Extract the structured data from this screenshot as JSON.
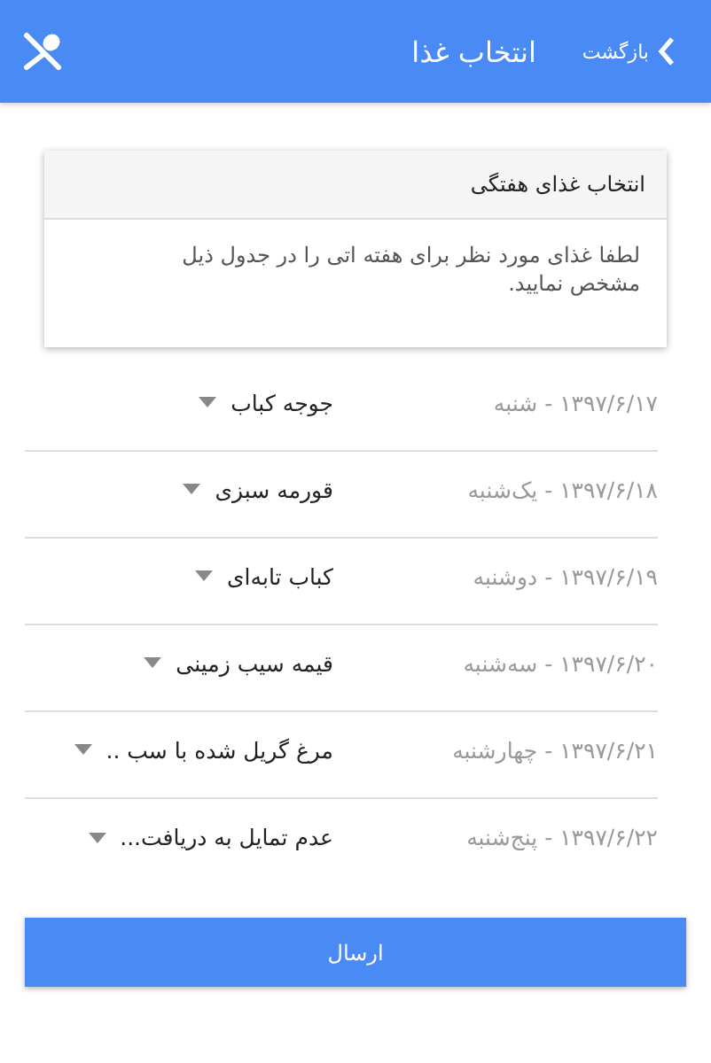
{
  "app_bar": {
    "back": "بازگشت",
    "title": "انتخاب غذا"
  },
  "card": {
    "title": "انتخاب غذای هفتگی",
    "text": "لطفا غذای مورد نظر برای هفته اتی را در جدول ذیل مشخص نمایید."
  },
  "rows": [
    {
      "date": "۱۳۹۷/۶/۱۷ - شنبه",
      "food": "جوجه کباب"
    },
    {
      "date": "۱۳۹۷/۶/۱۸ - یک‌شنبه",
      "food": "قورمه سبزی"
    },
    {
      "date": "۱۳۹۷/۶/۱۹ - دوشنبه",
      "food": "کباب تابه‌ای"
    },
    {
      "date": "۱۳۹۷/۶/۲۰ - سه‌شنبه",
      "food": "قیمه سیب زمینی"
    },
    {
      "date": "۱۳۹۷/۶/۲۱ - چهارشنبه",
      "food": "مرغ گریل شده با سب .."
    },
    {
      "date": "۱۳۹۷/۶/۲۲ - پنج‌شنبه",
      "food": "عدم تمایل به دریافت..."
    }
  ],
  "submit": "ارسال"
}
